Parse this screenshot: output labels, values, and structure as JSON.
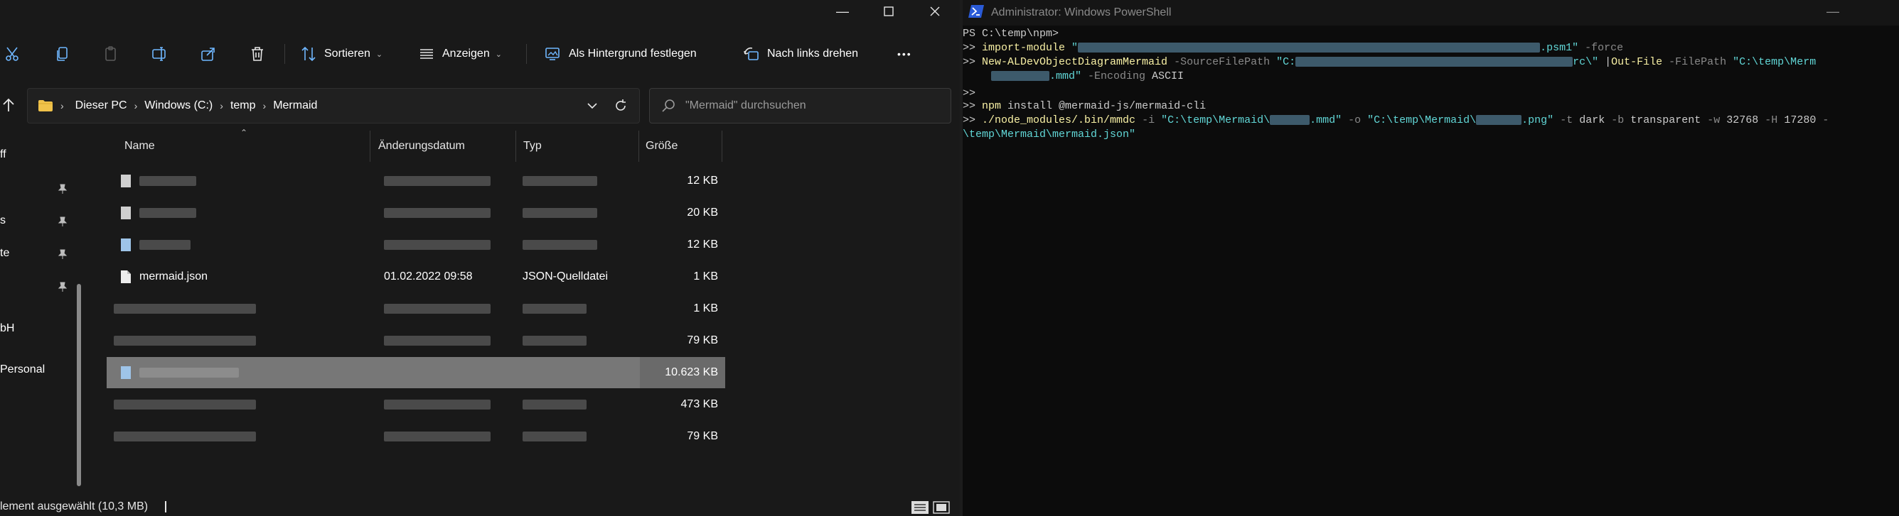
{
  "explorer": {
    "toolbar": {
      "sort_label": "Sortieren",
      "view_label": "Anzeigen",
      "wallpaper_label": "Als Hintergrund festlegen",
      "rotate_label": "Nach links drehen",
      "more_label": "•••"
    },
    "breadcrumb": [
      "Dieser PC",
      "Windows (C:)",
      "temp",
      "Mermaid"
    ],
    "search_placeholder": "\"Mermaid\" durchsuchen",
    "nav_items": [
      {
        "label": "ff",
        "pinned": false
      },
      {
        "label": "",
        "pinned": true
      },
      {
        "label": "s",
        "pinned": true
      },
      {
        "label": "te",
        "pinned": true
      },
      {
        "label": "",
        "pinned": true
      },
      {
        "label": "bH",
        "pinned": false
      },
      {
        "label": "Personal",
        "pinned": false
      }
    ],
    "columns": {
      "name": "Name",
      "date": "Änderungsdatum",
      "type": "Typ",
      "size": "Größe"
    },
    "files": [
      {
        "name": "",
        "date": "",
        "type": "",
        "size": "12 KB",
        "selected": false
      },
      {
        "name": "",
        "date": "",
        "type": "",
        "size": "20 KB",
        "selected": false
      },
      {
        "name": "",
        "date": "",
        "type": "",
        "size": "12 KB",
        "selected": false
      },
      {
        "name": "mermaid.json",
        "date": "01.02.2022 09:58",
        "type": "JSON-Quelldatei",
        "size": "1 KB",
        "selected": false
      },
      {
        "name": "",
        "date": "",
        "type": "",
        "size": "1 KB",
        "selected": false
      },
      {
        "name": "",
        "date": "",
        "type": "",
        "size": "79 KB",
        "selected": false
      },
      {
        "name": "",
        "date": "",
        "type": "",
        "size": "10.623 KB",
        "selected": true
      },
      {
        "name": "",
        "date": "",
        "type": "",
        "size": "473 KB",
        "selected": false
      },
      {
        "name": "",
        "date": "",
        "type": "",
        "size": "79 KB",
        "selected": false
      }
    ],
    "status": "lement ausgewählt (10,3 MB)"
  },
  "powershell": {
    "title": "Administrator: Windows PowerShell",
    "colors": {
      "command": "#f9f1a5",
      "string": "#61d6d6",
      "param": "#8a8a8a",
      "text": "#cccccc"
    },
    "lines": {
      "l1": "PS C:\\temp\\npm>",
      "l2_prompt": ">> ",
      "l2_cmd": "import-module",
      "l2_str_a": " \"",
      "l2_str_b": ".psm1\"",
      "l2_param": " -force",
      "l3_prompt": ">> ",
      "l3_cmd": "New-ALDevObjectDiagramMermaid",
      "l3_param": " -SourceFilePath",
      "l3_str_a": " \"C:",
      "l3_str_b": "rc\\\"",
      "l3_pipe": " |",
      "l3_cmd2": "Out-File",
      "l3_param2": " -FilePath",
      "l3_str_c": " \"C:\\temp\\Merm",
      "l4_str": ".mmd\"",
      "l4_param": " -Encoding",
      "l4_val": " ASCII",
      "l5": ">>",
      "l6_prompt": ">> ",
      "l6_cmd": "npm",
      "l6_rest": " install @mermaid-js/mermaid-cli",
      "l7_prompt": ">> ",
      "l7_cmd": "./node_modules/.bin/mmdc",
      "l7_p1": " -i",
      "l7_s1a": " \"C:\\temp\\Mermaid\\",
      "l7_s1b": ".mmd\"",
      "l7_p2": " -o",
      "l7_s2a": " \"C:\\temp\\Mermaid\\",
      "l7_s2b": ".png\"",
      "l7_p3": " -t",
      "l7_v3": " dark",
      "l7_p4": " -b",
      "l7_v4": " transparent",
      "l7_p5": " -w",
      "l7_v5": " 32768",
      "l7_p6": " -H",
      "l7_v6": " 17280",
      "l7_p7": " -",
      "l8_str": "\\temp\\Mermaid\\mermaid.json\""
    }
  }
}
